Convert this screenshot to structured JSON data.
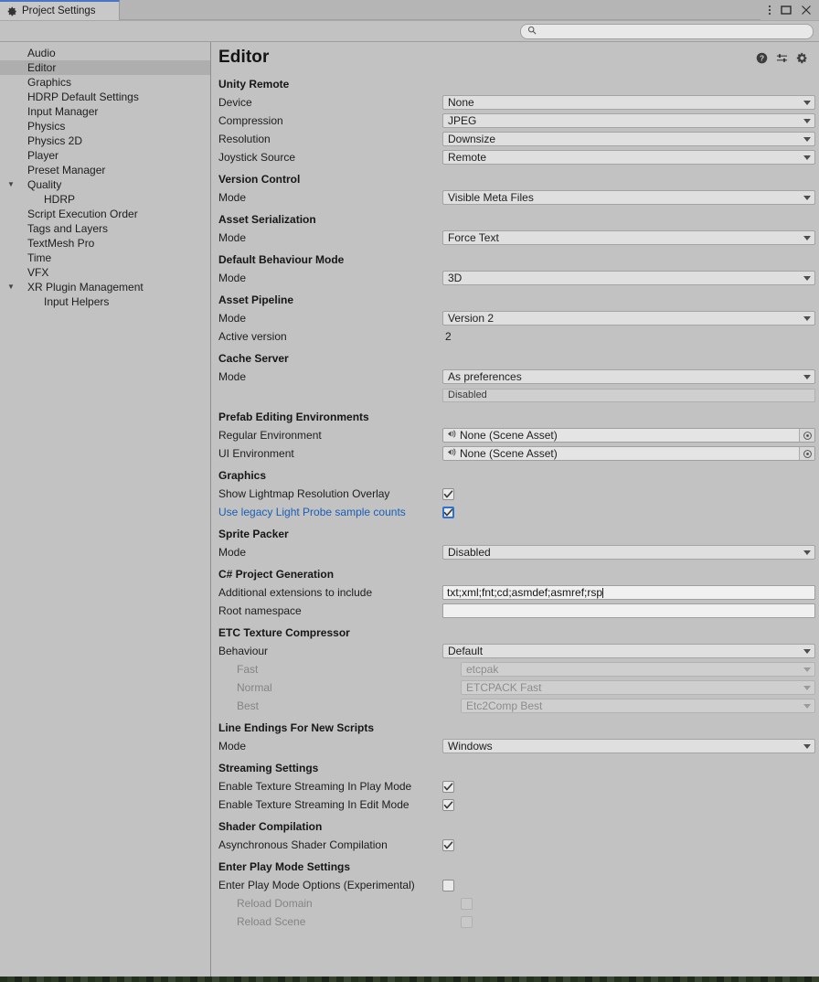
{
  "window": {
    "tab_label": "Project Settings",
    "tab_icon": "gear-icon",
    "controls": [
      "kebab-menu-icon",
      "maximize-icon",
      "close-icon"
    ]
  },
  "search": {
    "value": "",
    "placeholder": "",
    "icon": "search-icon"
  },
  "sidebar": {
    "items": [
      {
        "label": "Audio",
        "indent": 0,
        "arrow": "",
        "selected": false
      },
      {
        "label": "Editor",
        "indent": 0,
        "arrow": "",
        "selected": true
      },
      {
        "label": "Graphics",
        "indent": 0,
        "arrow": "",
        "selected": false
      },
      {
        "label": "HDRP Default Settings",
        "indent": 0,
        "arrow": "",
        "selected": false
      },
      {
        "label": "Input Manager",
        "indent": 0,
        "arrow": "",
        "selected": false
      },
      {
        "label": "Physics",
        "indent": 0,
        "arrow": "",
        "selected": false
      },
      {
        "label": "Physics 2D",
        "indent": 0,
        "arrow": "",
        "selected": false
      },
      {
        "label": "Player",
        "indent": 0,
        "arrow": "",
        "selected": false
      },
      {
        "label": "Preset Manager",
        "indent": 0,
        "arrow": "",
        "selected": false
      },
      {
        "label": "Quality",
        "indent": 0,
        "arrow": "▼",
        "selected": false
      },
      {
        "label": "HDRP",
        "indent": 1,
        "arrow": "",
        "selected": false
      },
      {
        "label": "Script Execution Order",
        "indent": 0,
        "arrow": "",
        "selected": false
      },
      {
        "label": "Tags and Layers",
        "indent": 0,
        "arrow": "",
        "selected": false
      },
      {
        "label": "TextMesh Pro",
        "indent": 0,
        "arrow": "",
        "selected": false
      },
      {
        "label": "Time",
        "indent": 0,
        "arrow": "",
        "selected": false
      },
      {
        "label": "VFX",
        "indent": 0,
        "arrow": "",
        "selected": false
      },
      {
        "label": "XR Plugin Management",
        "indent": 0,
        "arrow": "▼",
        "selected": false
      },
      {
        "label": "Input Helpers",
        "indent": 1,
        "arrow": "",
        "selected": false
      }
    ]
  },
  "page": {
    "title": "Editor",
    "header_icons": [
      "help-icon",
      "preset-icon",
      "settings-gear-icon"
    ]
  },
  "sections": [
    {
      "title": "Unity Remote",
      "rows": [
        {
          "label": "Device",
          "type": "dropdown",
          "value": "None"
        },
        {
          "label": "Compression",
          "type": "dropdown",
          "value": "JPEG"
        },
        {
          "label": "Resolution",
          "type": "dropdown",
          "value": "Downsize"
        },
        {
          "label": "Joystick Source",
          "type": "dropdown",
          "value": "Remote"
        }
      ]
    },
    {
      "title": "Version Control",
      "rows": [
        {
          "label": "Mode",
          "type": "dropdown",
          "value": "Visible Meta Files"
        }
      ]
    },
    {
      "title": "Asset Serialization",
      "rows": [
        {
          "label": "Mode",
          "type": "dropdown",
          "value": "Force Text"
        }
      ]
    },
    {
      "title": "Default Behaviour Mode",
      "rows": [
        {
          "label": "Mode",
          "type": "dropdown",
          "value": "3D"
        }
      ]
    },
    {
      "title": "Asset Pipeline",
      "rows": [
        {
          "label": "Mode",
          "type": "dropdown",
          "value": "Version 2"
        },
        {
          "label": "Active version",
          "type": "text-value",
          "value": "2"
        }
      ]
    },
    {
      "title": "Cache Server",
      "rows": [
        {
          "label": "Mode",
          "type": "dropdown",
          "value": "As preferences"
        },
        {
          "label": "",
          "type": "readonly",
          "value": "Disabled"
        }
      ]
    },
    {
      "title": "Prefab Editing Environments",
      "rows": [
        {
          "label": "Regular Environment",
          "type": "object",
          "value": "None (Scene Asset)"
        },
        {
          "label": "UI Environment",
          "type": "object",
          "value": "None (Scene Asset)"
        }
      ]
    },
    {
      "title": "Graphics",
      "rows": [
        {
          "label": "Show Lightmap Resolution Overlay",
          "type": "checkbox",
          "checked": true
        },
        {
          "label": "Use legacy Light Probe sample counts",
          "type": "checkbox",
          "checked": true,
          "focused": true,
          "link": true
        }
      ]
    },
    {
      "title": "Sprite Packer",
      "rows": [
        {
          "label": "Mode",
          "type": "dropdown",
          "value": "Disabled"
        }
      ]
    },
    {
      "title": "C# Project Generation",
      "rows": [
        {
          "label": "Additional extensions to include",
          "type": "textfield",
          "value": "txt;xml;fnt;cd;asmdef;asmref;rsp",
          "caret": true
        },
        {
          "label": "Root namespace",
          "type": "textfield",
          "value": ""
        }
      ]
    },
    {
      "title": "ETC Texture Compressor",
      "rows": [
        {
          "label": "Behaviour",
          "type": "dropdown",
          "value": "Default"
        },
        {
          "label": "Fast",
          "type": "dropdown",
          "value": "etcpak",
          "disabled": true,
          "sub": true
        },
        {
          "label": "Normal",
          "type": "dropdown",
          "value": "ETCPACK Fast",
          "disabled": true,
          "sub": true
        },
        {
          "label": "Best",
          "type": "dropdown",
          "value": "Etc2Comp Best",
          "disabled": true,
          "sub": true
        }
      ]
    },
    {
      "title": "Line Endings For New Scripts",
      "rows": [
        {
          "label": "Mode",
          "type": "dropdown",
          "value": "Windows"
        }
      ]
    },
    {
      "title": "Streaming Settings",
      "rows": [
        {
          "label": "Enable Texture Streaming In Play Mode",
          "type": "checkbox",
          "checked": true
        },
        {
          "label": "Enable Texture Streaming In Edit Mode",
          "type": "checkbox",
          "checked": true
        }
      ]
    },
    {
      "title": "Shader Compilation",
      "rows": [
        {
          "label": "Asynchronous Shader Compilation",
          "type": "checkbox",
          "checked": true
        }
      ]
    },
    {
      "title": "Enter Play Mode Settings",
      "rows": [
        {
          "label": "Enter Play Mode Options (Experimental)",
          "type": "checkbox",
          "checked": false
        },
        {
          "label": "Reload Domain",
          "type": "checkbox",
          "checked": false,
          "disabled": true,
          "sub": true
        },
        {
          "label": "Reload Scene",
          "type": "checkbox",
          "checked": false,
          "disabled": true,
          "sub": true
        }
      ]
    }
  ],
  "colors": {
    "background": "#c2c2c2",
    "field": "#dfdfdf",
    "selection": "#aeaeae",
    "accent_tab": "#4a76c8",
    "link": "#1a5fb4",
    "focus_border": "#2f70d0"
  }
}
